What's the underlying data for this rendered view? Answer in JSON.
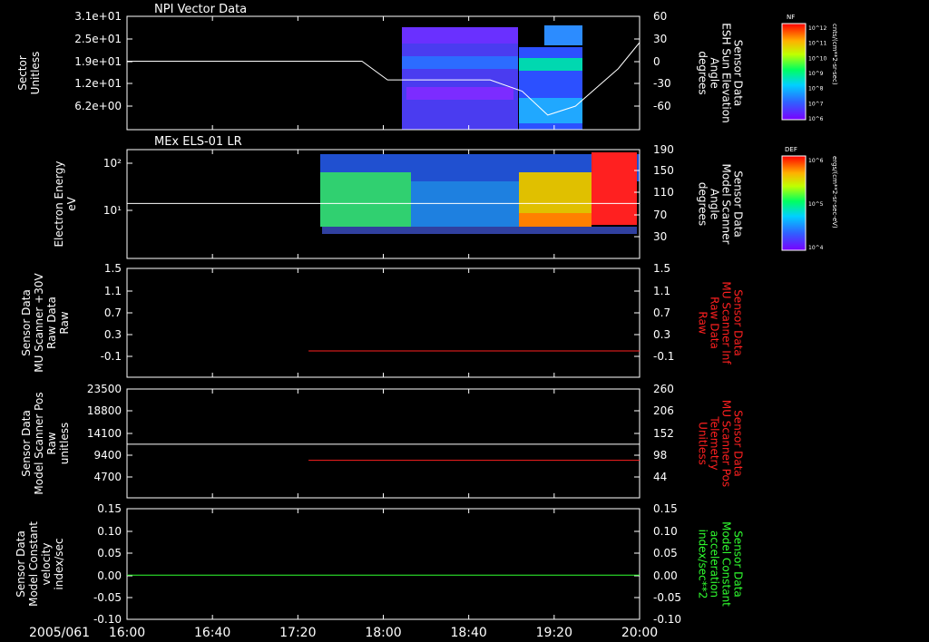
{
  "chart_data": [
    {
      "type": "heatmap",
      "title": "NPI Vector Data",
      "ylabel_left": [
        "Sector",
        "Unitless"
      ],
      "yticks_left": [
        "3.1e+01",
        "2.5e+01",
        "1.9e+01",
        "1.2e+01",
        "6.2e+00"
      ],
      "ylabel_right": [
        "Sensor Data",
        "ESH Sun Elevation",
        "Angle",
        "degrees"
      ],
      "yticks_right": [
        "60",
        "30",
        "0",
        "-30",
        "-60"
      ],
      "colorbar": {
        "label": "NF",
        "unit": "cnts/(cm**2-sr-sec)",
        "ticks": [
          "10^12",
          "10^11",
          "10^10",
          "10^9",
          "10^8",
          "10^7",
          "10^6"
        ]
      },
      "line_series": {
        "color": "#ffffff",
        "points": [
          [
            "16:00",
            0
          ],
          [
            "17:50",
            0
          ],
          [
            "18:02",
            -25
          ],
          [
            "18:50",
            -25
          ],
          [
            "19:05",
            -40
          ],
          [
            "19:17",
            -72
          ],
          [
            "19:30",
            -60
          ],
          [
            "19:50",
            -10
          ],
          [
            "20:00",
            25
          ]
        ]
      }
    },
    {
      "type": "heatmap",
      "title": "MEx ELS-01 LR",
      "ylabel_left": [
        "Electron Energy",
        "eV"
      ],
      "yticks_left": [
        "10²",
        "10¹"
      ],
      "ylabel_right": [
        "Sensor Data",
        "Model Scanner",
        "Angle",
        "degrees"
      ],
      "yticks_right": [
        "190",
        "150",
        "110",
        "70",
        "30"
      ],
      "colorbar": {
        "label": "DEF",
        "unit": "ergs/(cm**2-sr-sec-eV)",
        "ticks": [
          "10^6",
          "10^5",
          "10^4"
        ]
      },
      "line_series": {
        "color": "#ffffff",
        "points": [
          [
            "16:00",
            14
          ],
          [
            "20:00",
            14
          ]
        ]
      }
    },
    {
      "type": "line",
      "ylabel_left": [
        "Sensor Data",
        "MU Scanner +30V",
        "Raw Data",
        "Raw"
      ],
      "yticks_left": [
        "1.5",
        "1.1",
        "0.7",
        "0.3",
        "-0.1"
      ],
      "ylabel_right": [
        "Sensor Data",
        "MU Scanner Inf",
        "Raw Data",
        "Raw"
      ],
      "yticks_right": [
        "1.5",
        "1.1",
        "0.7",
        "0.3",
        "-0.1"
      ],
      "series": [
        {
          "color": "#ff2020",
          "points": [
            [
              "17:25",
              0.0
            ],
            [
              "20:00",
              0.0
            ]
          ]
        }
      ]
    },
    {
      "type": "line",
      "ylabel_left": [
        "Sensor Data",
        "Model Scanner Pos",
        "Raw",
        "unitless"
      ],
      "yticks_left": [
        "23500",
        "18800",
        "14100",
        "9400",
        "4700"
      ],
      "ylabel_right": [
        "Sensor Data",
        "MU Scanner Pos",
        "Telemetry",
        "Unitless"
      ],
      "yticks_right": [
        "260",
        "206",
        "152",
        "98",
        "44"
      ],
      "series": [
        {
          "color": "#ffffff",
          "points": [
            [
              "16:00",
              11700
            ],
            [
              "20:00",
              11700
            ]
          ]
        },
        {
          "color": "#ff2020",
          "points": [
            [
              "17:25",
              85
            ],
            [
              "20:00",
              85
            ]
          ]
        }
      ]
    },
    {
      "type": "line",
      "ylabel_left": [
        "Sensor Data",
        "Model Constant",
        "velocity",
        "index/sec"
      ],
      "yticks_left": [
        "0.15",
        "0.10",
        "0.05",
        "0.00",
        "-0.05",
        "-0.10"
      ],
      "ylabel_right": [
        "Sensor Data",
        "Model Constant",
        "acceleration",
        "index/sec**2"
      ],
      "yticks_right": [
        "0.15",
        "0.10",
        "0.05",
        "0.00",
        "-0.05",
        "-0.10"
      ],
      "series": [
        {
          "color": "#30ff30",
          "points": [
            [
              "16:00",
              0.0
            ],
            [
              "20:00",
              0.0
            ]
          ]
        }
      ]
    }
  ],
  "xaxis": {
    "date": "2005/061",
    "ticks": [
      "16:00",
      "16:40",
      "17:20",
      "18:00",
      "18:40",
      "19:20",
      "20:00"
    ]
  },
  "colors": {
    "red": "#ff2020",
    "green": "#30ff30",
    "white": "#ffffff"
  }
}
